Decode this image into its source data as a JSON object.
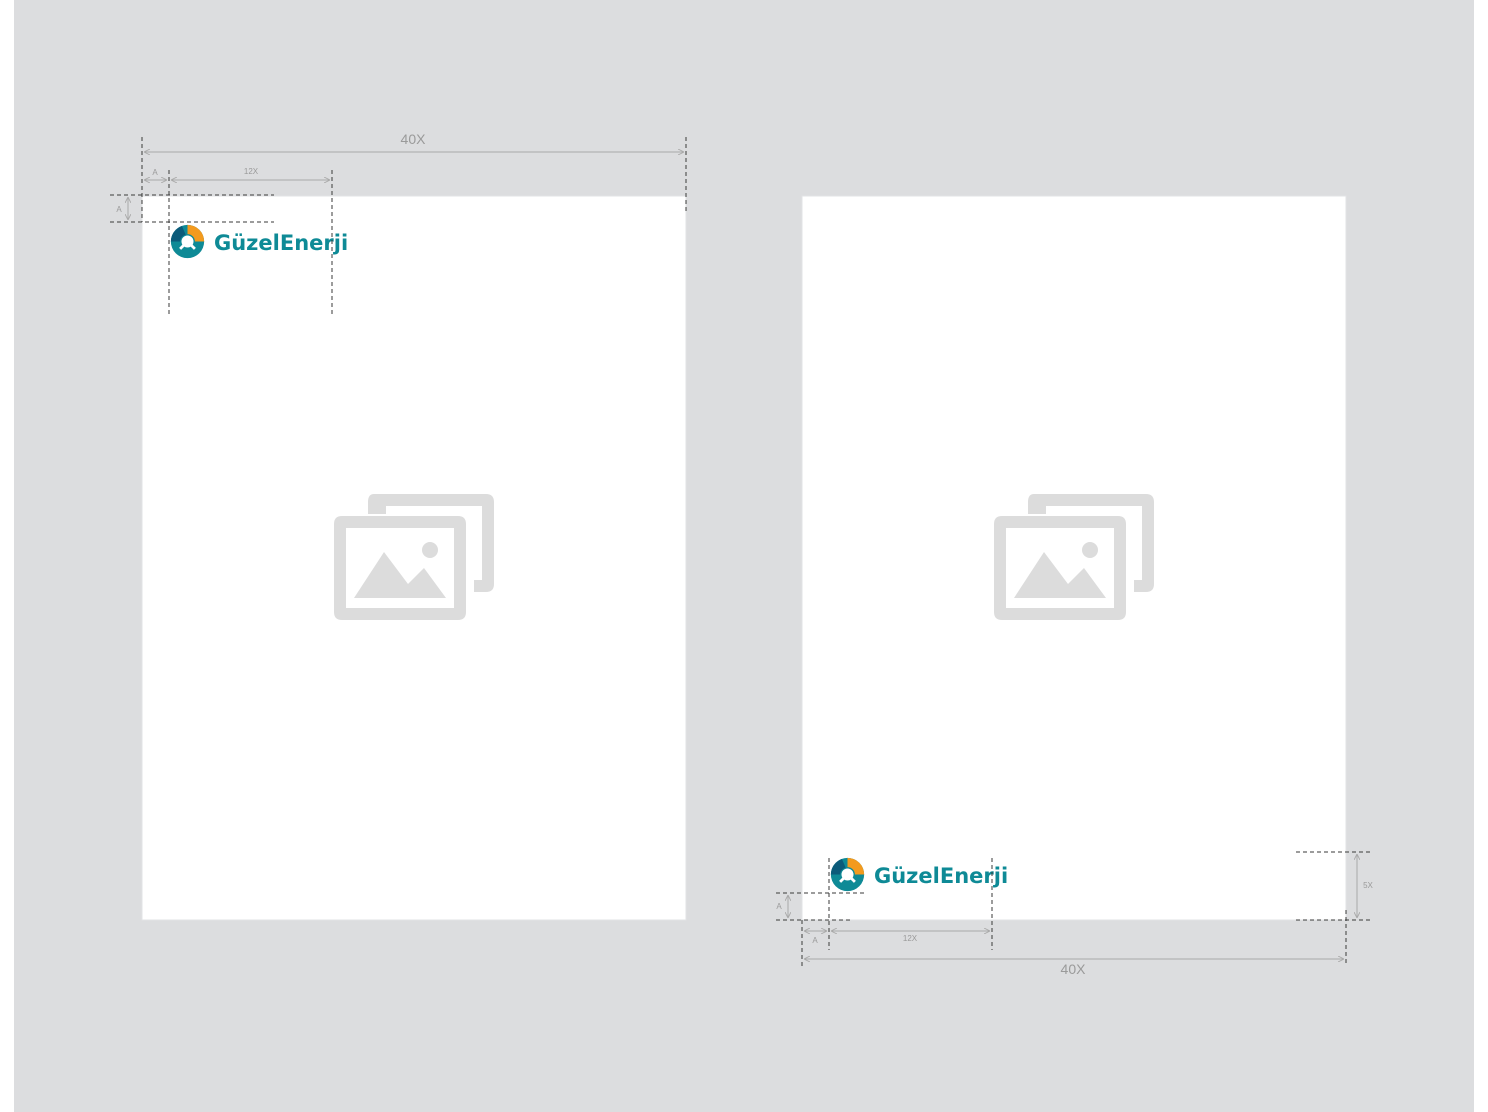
{
  "colors": {
    "canvas": "#dcdddf",
    "page": "#ffffff",
    "page_border": "#e2e3e5",
    "guide": "#3a3a3a",
    "dimension": "#a9a9a9",
    "label": "#9a9a9a",
    "placeholder": "#dcdcdc",
    "brand_teal": "#0e8a96",
    "brand_orange": "#f39a1e",
    "brand_dark": "#0b5b7a"
  },
  "brand": {
    "name": "GüzelEnerji"
  },
  "layouts": [
    {
      "id": "top-left",
      "width_label": "40X",
      "logo_width_label": "12X",
      "margin_x_label": "A",
      "margin_y_label": "A",
      "placeholder_icon": "image-gallery-icon"
    },
    {
      "id": "bottom-left",
      "width_label": "40X",
      "logo_width_label": "12X",
      "margin_x_label": "A",
      "margin_y_label": "A",
      "band_height_label": "5X",
      "placeholder_icon": "image-gallery-icon"
    }
  ]
}
